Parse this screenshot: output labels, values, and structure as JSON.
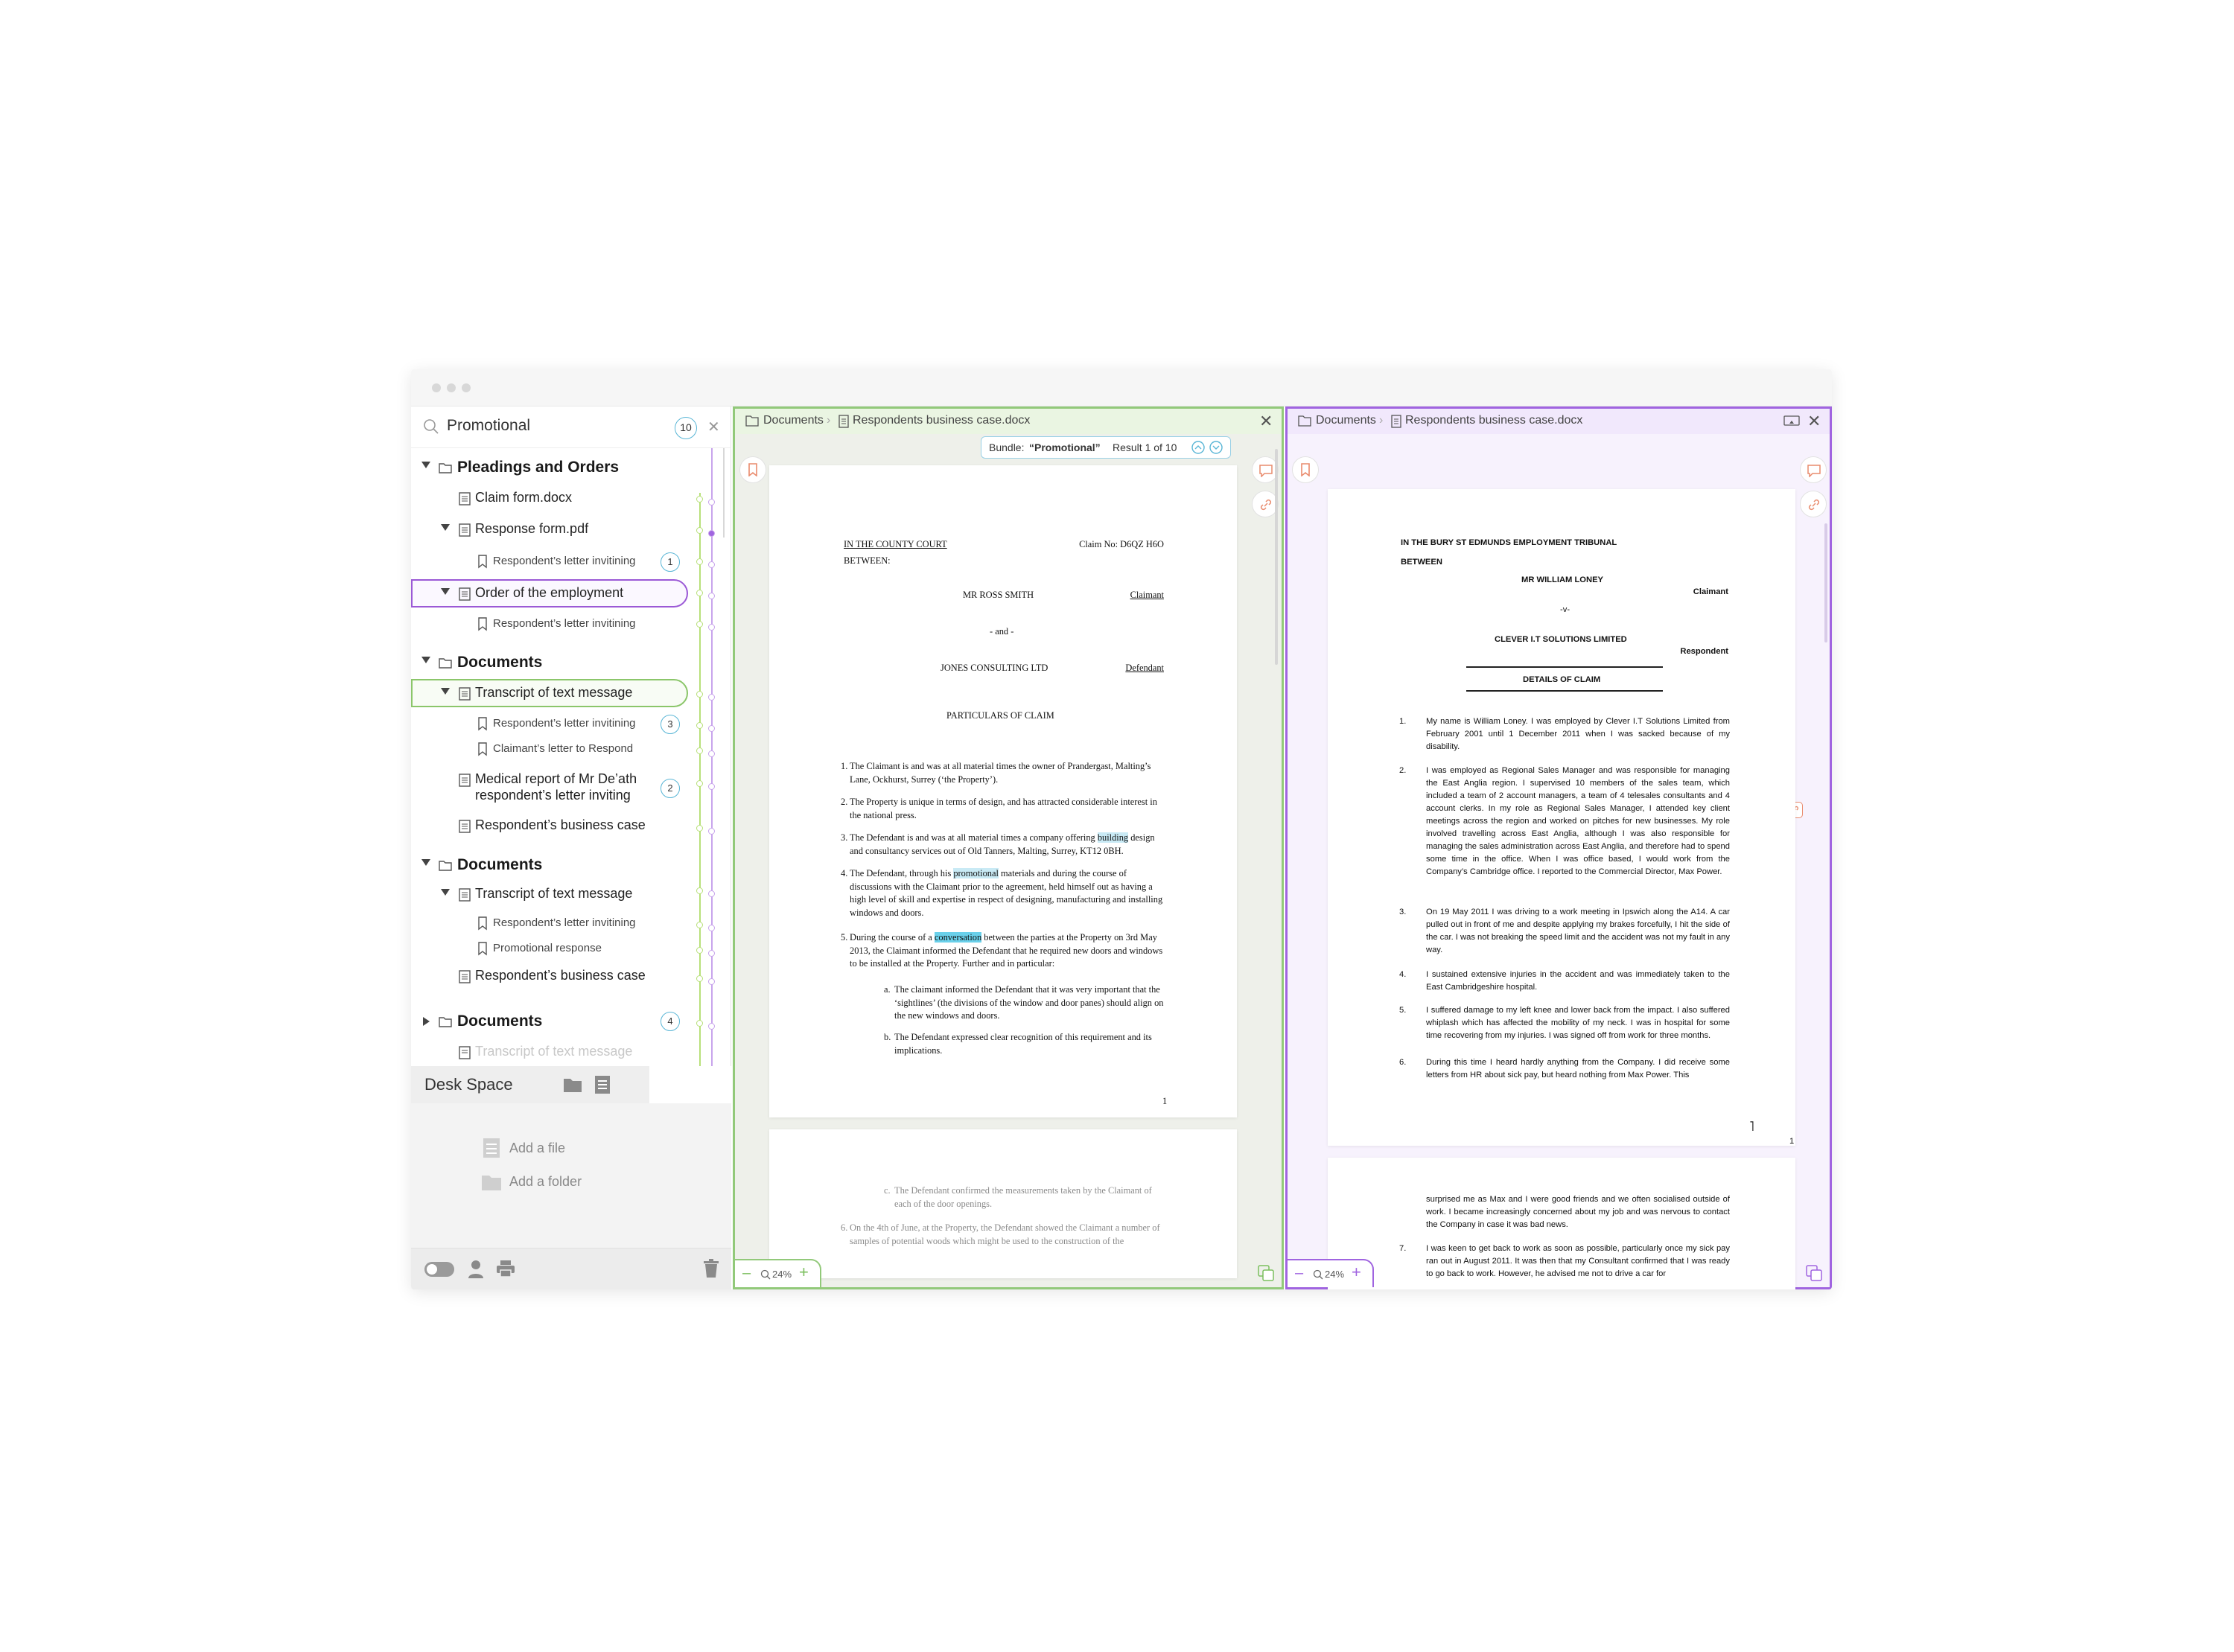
{
  "search": {
    "query": "Promotional",
    "count": "10"
  },
  "tree": [
    {
      "kind": "f",
      "label": "Pleadings and Orders"
    },
    {
      "kind": "d",
      "label": "Claim form.docx"
    },
    {
      "kind": "d",
      "label": "Response form.pdf"
    },
    {
      "kind": "b",
      "label": "Respondent’s letter invitining",
      "badge": "1"
    },
    {
      "kind": "d",
      "label": "Order of the employment"
    },
    {
      "kind": "b",
      "label": "Respondent’s letter invitining"
    },
    {
      "kind": "f",
      "label": "Documents"
    },
    {
      "kind": "d",
      "label": "Transcript of text message"
    },
    {
      "kind": "b",
      "label": "Respondent’s letter invitining",
      "badge": "3"
    },
    {
      "kind": "b",
      "label": "Claimant’s letter to Respond"
    },
    {
      "kind": "d",
      "label": "Medical report of Mr De’ath",
      "label2": "respondent’s letter inviting",
      "badge": "2"
    },
    {
      "kind": "d",
      "label": "Respondent’s business case"
    },
    {
      "kind": "f",
      "label": "Documents"
    },
    {
      "kind": "d",
      "label": "Transcript of text message"
    },
    {
      "kind": "b",
      "label": "Respondent’s letter invitining"
    },
    {
      "kind": "b",
      "label": "Promotional response"
    },
    {
      "kind": "d",
      "label": "Respondent’s business case"
    },
    {
      "kind": "f",
      "label": "Documents",
      "badge": "4"
    },
    {
      "kind": "d",
      "label": "Transcript of text message"
    }
  ],
  "desk": {
    "title": "Desk Space",
    "add_file": "Add a file",
    "add_folder": "Add a folder"
  },
  "pane_left": {
    "crumb_root": "Documents",
    "crumb_file": "Respondents business case.docx",
    "result_prefix": "Bundle:",
    "result_term": "“Promotional”",
    "result_count": "Result 1 of 10",
    "zoom": "24%",
    "doc": {
      "court": "IN THE COUNTY COURT",
      "claim_no": "Claim No: D6QZ H6O",
      "between": "BETWEEN:",
      "party1": "MR ROSS SMITH",
      "role1": "Claimant",
      "and": "- and -",
      "party2": "JONES CONSULTING LTD",
      "role2": "Defendant",
      "heading": "PARTICULARS OF CLAIM",
      "p1": "The Claimant is and was at all material times the owner of Prandergast, Malting’s Lane, Ockhurst, Surrey (‘the Property’).",
      "p2": "The Property is unique in terms of design, and has attracted considerable interest in the national press.",
      "p3a": "The Defendant is and was at all material times a company offering ",
      "p3h": "building",
      "p3b": " design and consultancy services out of Old Tanners, Malting, Surrey, KT12 0BH.",
      "p4a": "The Defendant, through his ",
      "p4h": "promotional",
      "p4b": " materials and during the course of discussions with the Claimant prior to the agreement, held himself out as having a high level of skill and expertise in respect of designing, manufacturing and installing windows and doors.",
      "p5a": "During the course of a ",
      "p5h": "conversation",
      "p5b": " between the parties at the Property on 3rd May 2013, the Claimant informed the Defendant that he required new doors and windows to be installed at the Property. Further and in particular:",
      "pa": "The claimant informed the Defendant that it was very important that the ‘sightlines’ (the divisions of the window and door panes) should align on the new windows and doors.",
      "pb": "The Defendant expressed clear recognition of this requirement and its implications.",
      "page_no": "1",
      "pc": "The Defendant confirmed the measurements taken by the Claimant of each of the door openings.",
      "p6": "On the 4th of June, at the Property, the Defendant showed the Claimant a number of samples of potential woods which might be used to the construction of the"
    }
  },
  "pane_right": {
    "crumb_root": "Documents",
    "crumb_file": "Respondents business case.docx",
    "zoom": "24%",
    "doc": {
      "tribunal": "IN THE BURY ST EDMUNDS EMPLOYMENT TRIBUNAL",
      "between": "BETWEEN",
      "party1": "MR WILLIAM LONEY",
      "role1": "Claimant",
      "v": "-v-",
      "party2": "CLEVER I.T SOLUTIONS LIMITED",
      "role2": "Respondent",
      "heading": "DETAILS OF CLAIM",
      "p1": "My name is William Loney. I was employed by Clever I.T Solutions Limited from February 2001 until 1 December 2011 when I was sacked because of my disability.",
      "p2": "I was employed as Regional Sales Manager and was responsible for managing the East Anglia region. I supervised 10 members of the sales team, which included a team of 2 account managers, a team of 4 telesales consultants and 4 account clerks. In my role as Regional Sales Manager, I attended key client meetings across the region and worked on pitches for new businesses. My role involved travelling across East Anglia, although I was also responsible for managing the sales administration across East Anglia, and therefore had to spend some time in the office. When I was office based, I would work from the Company’s Cambridge office. I reported to the Commercial Director, Max Power.",
      "p3": "On 19 May 2011 I was driving to a work meeting in Ipswich along the A14. A car pulled out in front of me and despite applying my brakes forcefully, I hit the side of the car. I was not breaking the speed limit and the accident was not my fault in any way.",
      "p4": "I sustained extensive injuries in the accident and was immediately taken to the East Cambridgeshire hospital.",
      "p5": "I suffered damage to my left knee and lower back from the impact. I also suffered whiplash which has affected the mobility of my neck. I was in hospital for some time recovering from my injuries. I was signed off from work for three months.",
      "p6": "During this time I heard hardly anything from the Company. I did receive some letters from HR about sick pay, but heard nothing from Max Power. This",
      "page_no": "1",
      "c1": "surprised me as Max and I were good friends and we often socialised outside of work. I became increasingly concerned about my job and was nervous to contact the Company in case it was bad news.",
      "p7": "I was keen to get back to work as soon as possible, particularly once my sick pay ran out in August 2011. It was then that my Consultant confirmed that I was ready to go back to work. However, he advised me not to drive a car for"
    }
  }
}
